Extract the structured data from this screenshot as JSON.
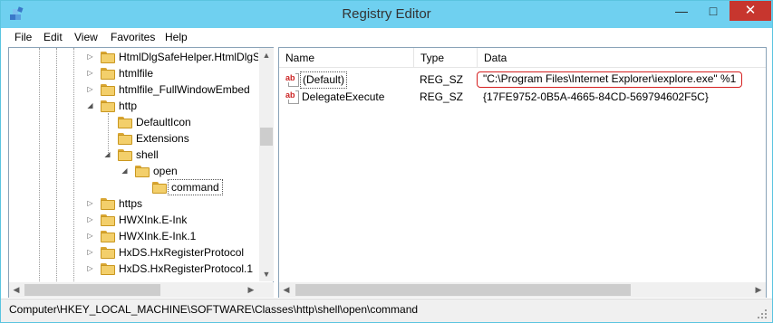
{
  "window": {
    "title": "Registry Editor",
    "minimize_glyph": "—",
    "maximize_glyph": "□",
    "close_glyph": "✕",
    "title_color": "#6fd0f0",
    "close_color": "#c7362e"
  },
  "menu": {
    "items": [
      "File",
      "Edit",
      "View",
      "Favorites",
      "Help"
    ]
  },
  "tree": {
    "items": [
      {
        "label": "HtmlDlgSafeHelper.HtmlDlgS",
        "expander": "▷"
      },
      {
        "label": "htmlfile",
        "expander": "▷"
      },
      {
        "label": "htmlfile_FullWindowEmbed",
        "expander": "▷"
      },
      {
        "label": "http",
        "expander": "◢"
      },
      {
        "label": "DefaultIcon",
        "expander": ""
      },
      {
        "label": "Extensions",
        "expander": ""
      },
      {
        "label": "shell",
        "expander": "◢"
      },
      {
        "label": "open",
        "expander": "◢"
      },
      {
        "label": "command",
        "expander": ""
      },
      {
        "label": "https",
        "expander": "▷"
      },
      {
        "label": "HWXInk.E-Ink",
        "expander": "▷"
      },
      {
        "label": "HWXInk.E-Ink.1",
        "expander": "▷"
      },
      {
        "label": "HxDS.HxRegisterProtocol",
        "expander": "▷"
      },
      {
        "label": "HxDS.HxRegisterProtocol.1",
        "expander": "▷"
      }
    ],
    "scroll_up": "▲",
    "scroll_down": "▼",
    "scroll_left": "◀",
    "scroll_right": "▶"
  },
  "values": {
    "columns": [
      "Name",
      "Type",
      "Data"
    ],
    "rows": [
      {
        "name": "(Default)",
        "type": "REG_SZ",
        "data": "\"C:\\Program Files\\Internet Explorer\\iexplore.exe\" %1"
      },
      {
        "name": "DelegateExecute",
        "type": "REG_SZ",
        "data": "{17FE9752-0B5A-4665-84CD-569794602F5C}"
      }
    ],
    "icon_text": "ab",
    "scroll_left": "◀",
    "scroll_right": "▶"
  },
  "status": {
    "path": "Computer\\HKEY_LOCAL_MACHINE\\SOFTWARE\\Classes\\http\\shell\\open\\command"
  }
}
